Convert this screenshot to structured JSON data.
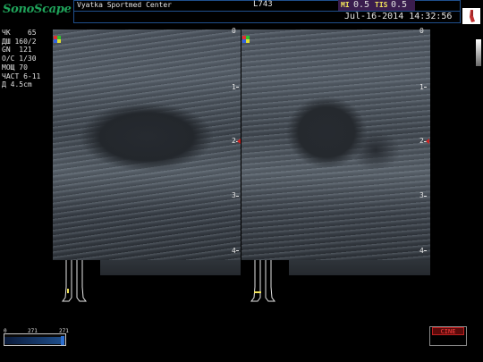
{
  "header": {
    "brand": "SonoScape",
    "center_name": "Vyatka Sportmed Center",
    "probe": "L743",
    "mi_label": "MI",
    "mi_value": "0.5",
    "tis_label": "TIS",
    "tis_value": "0.5",
    "datetime": "Jul-16-2014 14:32:56"
  },
  "params": [
    {
      "label": "ЧК",
      "value": "65"
    },
    {
      "label": "ДШ",
      "value": "160/2"
    },
    {
      "label": "GN",
      "value": "121"
    },
    {
      "label": "O/C",
      "value": "1/30"
    },
    {
      "label": "МОЩ",
      "value": "70"
    },
    {
      "label": "ЧАСТ",
      "value": "6-11"
    },
    {
      "label": "Д",
      "value": "4.5cm"
    }
  ],
  "depth_marks": [
    "0",
    "1",
    "2",
    "3",
    "4"
  ],
  "cine": {
    "label": "CINE",
    "scale_min": "0",
    "scale_mid": "271",
    "scale_max": "271"
  },
  "colors": {
    "brand": "#1fa35a",
    "header_border": "#1f4f8c",
    "mi_box": "#3a1d4e",
    "label_yellow": "#f2e35a",
    "cine_red": "#ff4040"
  }
}
